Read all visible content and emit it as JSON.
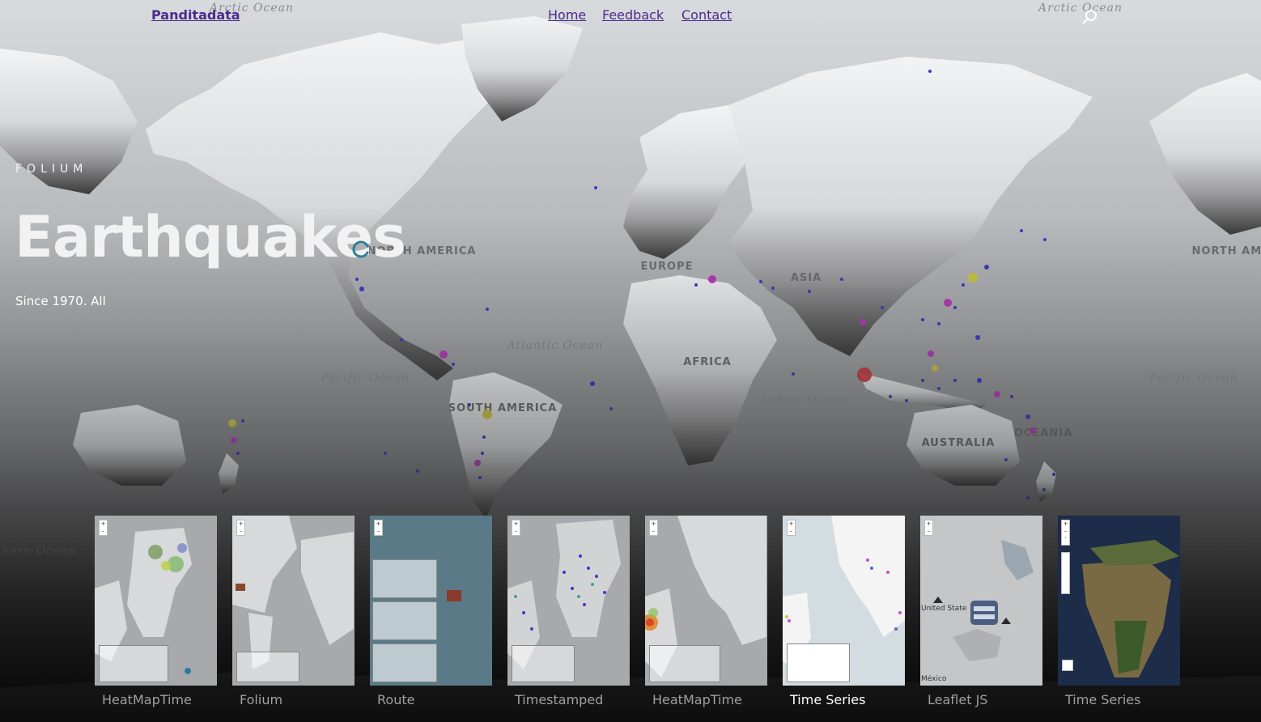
{
  "nav": {
    "brand": "Panditadata",
    "links": [
      "Home",
      "Feedback",
      "Contact"
    ]
  },
  "hero": {
    "kicker": "FOLIUM",
    "title": "Earthquakes",
    "subtitle": "Since 1970. All"
  },
  "map_labels": {
    "continents": [
      "NORTH AMERICA",
      "EUROPE",
      "ASIA",
      "AFRICA",
      "SOUTH AMERICA",
      "AUSTRALIA",
      "OCEANIA",
      "NORTH AMERICA"
    ],
    "oceans": [
      "Arctic Ocean",
      "Atlantic Ocean",
      "Pacific Ocean",
      "Indian Ocean",
      "Southern Ocean",
      "Pacific Ocean",
      "Arctic Ocean"
    ]
  },
  "gallery": {
    "cards": [
      {
        "label": "HeatMapTime",
        "active": false
      },
      {
        "label": "Folium",
        "active": false
      },
      {
        "label": "Route",
        "active": false
      },
      {
        "label": "Timestamped",
        "active": false
      },
      {
        "label": "HeatMapTime",
        "active": false
      },
      {
        "label": "Time Series",
        "active": true
      },
      {
        "label": "Leaflet JS",
        "active": false
      },
      {
        "label": "Time Series",
        "active": false
      }
    ],
    "thumb_texts": {
      "leaflet_state": "United State",
      "leaflet_mexico": "México"
    }
  },
  "icons": [
    "search-icon",
    "loading-spinner-icon",
    "zoom-in-icon",
    "zoom-out-icon",
    "fullscreen-icon",
    "play-icon",
    "move-icon"
  ],
  "colors": {
    "brand_link": "#4b2a8c",
    "land": "#e4e5e6",
    "water": "#a7a9ac",
    "quake_small": "#3b3bc4",
    "quake_mid": "#b43cb8",
    "quake_alt": "#c9c845",
    "quake_large": "#c8343c"
  }
}
